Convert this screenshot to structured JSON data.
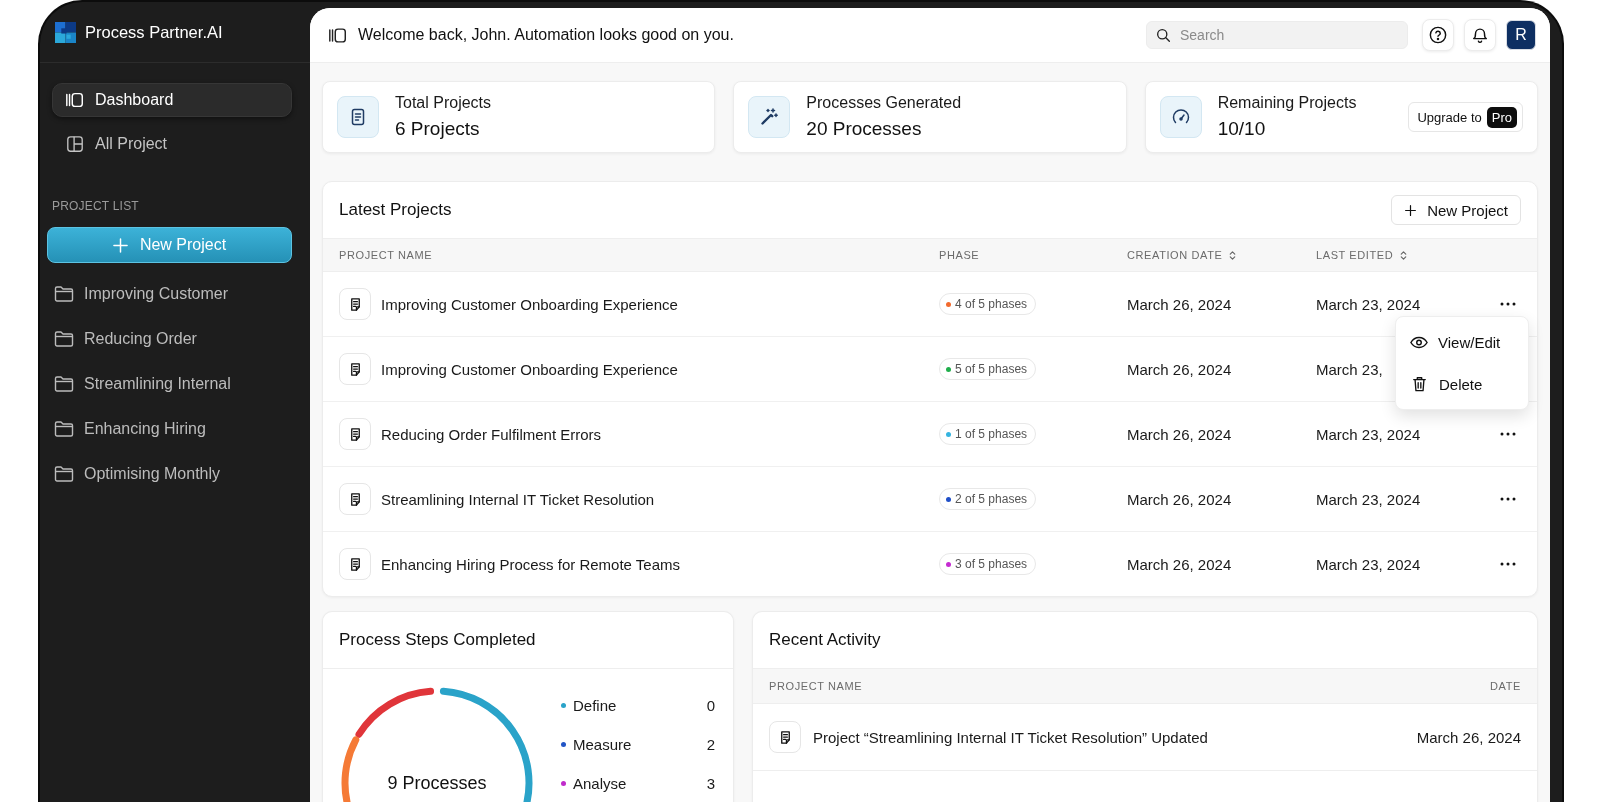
{
  "app": {
    "name": "Process Partner.AI"
  },
  "sidebar": {
    "items": [
      {
        "kind": "dashboard",
        "label": "Dashboard",
        "selected": true
      },
      {
        "kind": "projects",
        "label": "All Project",
        "selected": false
      }
    ],
    "section_title": "PROJECT LIST",
    "new_project_button": "New Project",
    "projects": [
      {
        "label": "Improving Customer"
      },
      {
        "label": "Reducing Order"
      },
      {
        "label": "Streamlining Internal"
      },
      {
        "label": "Enhancing Hiring"
      },
      {
        "label": "Optimising Monthly"
      }
    ]
  },
  "header": {
    "greeting": "Welcome back, John. Automation looks good on you.",
    "search": {
      "placeholder": "Search"
    },
    "avatar": "R"
  },
  "stats": [
    {
      "kind": "document",
      "title": "Total Projects",
      "value": "6 Projects"
    },
    {
      "kind": "wand",
      "title": "Processes Generated",
      "value": "20 Processes"
    },
    {
      "kind": "gauge",
      "title": "Remaining Projects",
      "value": "10/10",
      "upgrade": {
        "label": "Upgrade to",
        "badge": "Pro"
      }
    }
  ],
  "latest_projects": {
    "title": "Latest Projects",
    "new_project_button": "New Project",
    "columns": [
      {
        "label": "PROJECT NAME",
        "sortable": false
      },
      {
        "label": "PHASE",
        "sortable": false
      },
      {
        "label": "CREATION DATE",
        "sortable": true
      },
      {
        "label": "LAST EDITED",
        "sortable": true
      }
    ],
    "rows": [
      {
        "name": "Improving Customer Onboarding Experience",
        "phase": "4 of 5 phases",
        "color": "#f26a2e",
        "created": "March 26, 2024",
        "edited": "March 23, 2024",
        "menu": {
          "items": [
            {
              "kind": "view",
              "label": "View/Edit"
            },
            {
              "kind": "delete",
              "label": "Delete"
            }
          ]
        }
      },
      {
        "name": "Improving Customer Onboarding Experience",
        "phase": "5 of 5 phases",
        "color": "#1fae4b",
        "created": "March 26, 2024",
        "edited": "March 23,"
      },
      {
        "name": "Reducing Order Fulfilment Errors",
        "phase": "1 of 5 phases",
        "color": "#35b4e0",
        "created": "March 26, 2024",
        "edited": "March 23, 2024"
      },
      {
        "name": "Streamlining Internal IT Ticket Resolution",
        "phase": "2 of 5 phases",
        "color": "#1f4fc8",
        "created": "March 26, 2024",
        "edited": "March 23, 2024"
      },
      {
        "name": "Enhancing Hiring Process for Remote Teams",
        "phase": "3 of 5 phases",
        "color": "#c52bd1",
        "created": "March 26, 2024",
        "edited": "March 23, 2024"
      }
    ]
  },
  "process_steps": {
    "title": "Process Steps Completed",
    "total": "9 Processes",
    "legend": [
      {
        "label": "Define",
        "count": "0",
        "color": "#2aa3c9"
      },
      {
        "label": "Measure",
        "count": "2",
        "color": "#2255c6"
      },
      {
        "label": "Analyse",
        "count": "3",
        "color": "#c02bcb"
      }
    ]
  },
  "recent_activity": {
    "title": "Recent Activity",
    "columns": [
      {
        "label": "PROJECT NAME"
      },
      {
        "label": "DATE"
      }
    ],
    "rows": [
      {
        "text": "Project “Streamlining Internal IT Ticket Resolution” Updated",
        "date": "March 26, 2024"
      }
    ]
  }
}
